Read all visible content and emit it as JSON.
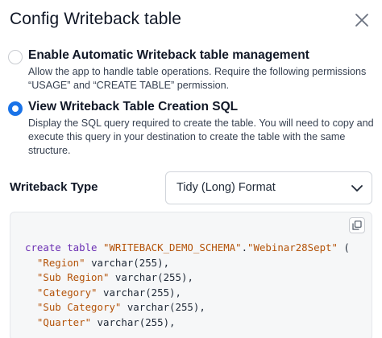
{
  "dialog": {
    "title": "Config Writeback table"
  },
  "options": [
    {
      "title": "Enable Automatic Writeback table management",
      "description": "Allow the app to handle table operations. Require the following permissions “USAGE” and “CREATE TABLE” permission.",
      "selected": false
    },
    {
      "title": "View Writeback Table Creation SQL",
      "description": "Display the SQL query required to create the table. You will need to copy and execute this query in your destination to create the table with the same structure.",
      "selected": true
    }
  ],
  "writeback_type": {
    "label": "Writeback Type",
    "selected": "Tidy (Long) Format"
  },
  "sql": {
    "line1": {
      "keyword": "create table",
      "schema": "\"WRITEBACK_DEMO_SCHEMA\"",
      "dot": ".",
      "table": "\"Webinar28Sept\"",
      "paren": " ("
    },
    "columns": [
      {
        "name": "\"Region\"",
        "type": "varchar(255),",
        "indent": "  "
      },
      {
        "name": "\"Sub Region\"",
        "type": "varchar(255),",
        "indent": "  "
      },
      {
        "name": "\"Category\"",
        "type": "varchar(255),",
        "indent": "  "
      },
      {
        "name": "\"Sub Category\"",
        "type": "varchar(255),",
        "indent": "  "
      },
      {
        "name": "\"Quarter\"",
        "type": "varchar(255),",
        "indent": "  "
      }
    ]
  },
  "icons": {
    "close": "close-icon",
    "copy": "copy-icon",
    "chevron": "chevron-down-icon"
  },
  "colors": {
    "accent": "#1a73e8",
    "keyword": "#6b2fb3",
    "string": "#b45309"
  }
}
